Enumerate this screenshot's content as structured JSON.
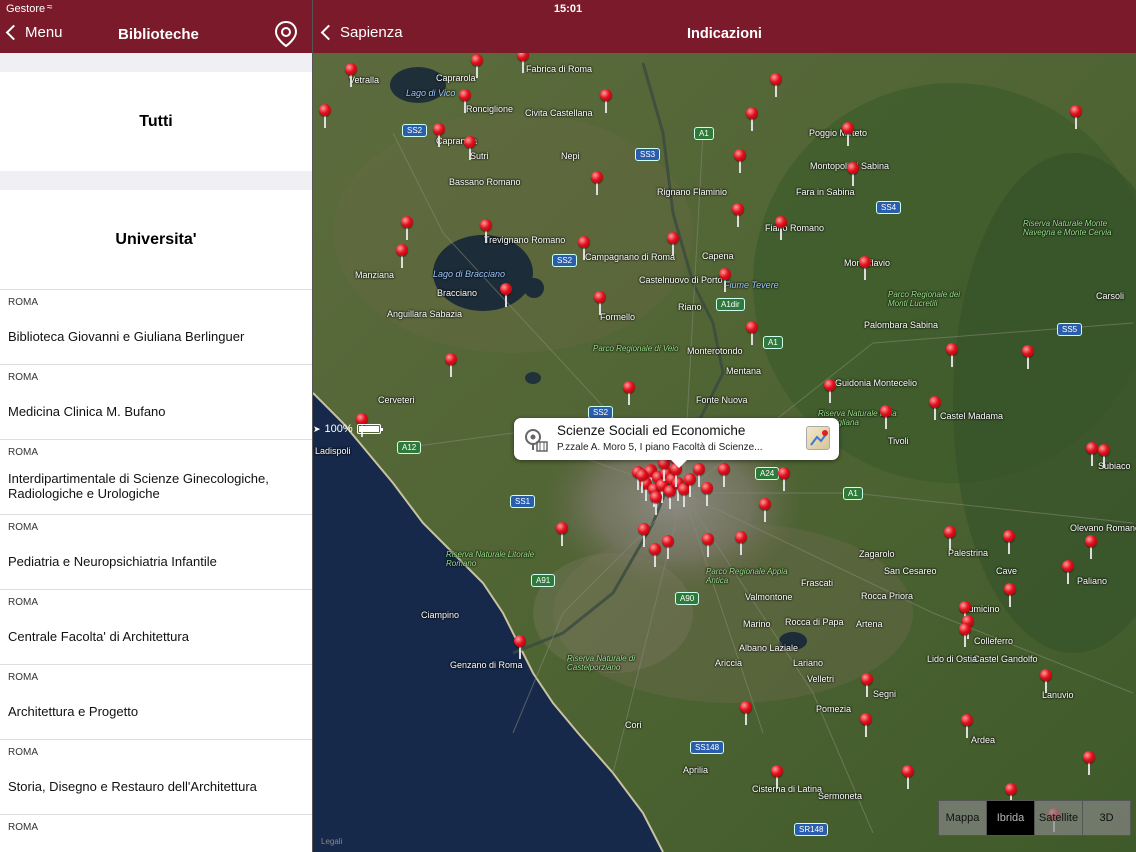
{
  "status": {
    "carrier": "Gestore",
    "time": "15:01",
    "battery": "100%"
  },
  "left_nav": {
    "back_label": "Menu",
    "title": "Biblioteche"
  },
  "right_nav": {
    "back_label": "Sapienza",
    "title": "Indicazioni"
  },
  "list": {
    "all_label": "Tutti",
    "section_label": "Universita'",
    "items": [
      {
        "city": "ROMA",
        "name": "Biblioteca Giovanni e Giuliana Berlinguer"
      },
      {
        "city": "ROMA",
        "name": "Medicina Clinica M. Bufano"
      },
      {
        "city": "ROMA",
        "name": "Interdipartimentale  di Scienze Ginecologiche, Radiologiche e Urologiche"
      },
      {
        "city": "ROMA",
        "name": "Pediatria e Neuropsichiatria Infantile"
      },
      {
        "city": "ROMA",
        "name": "Centrale Facolta' di Architettura"
      },
      {
        "city": "ROMA",
        "name": "Architettura e Progetto"
      },
      {
        "city": "ROMA",
        "name": "Storia, Disegno e Restauro dell'Architettura"
      },
      {
        "city": "ROMA",
        "name": ""
      }
    ]
  },
  "map": {
    "callout": {
      "title": "Scienze Sociali ed Economiche",
      "subtitle": "P.zzale A. Moro 5, I piano Facoltà di Scienze..."
    },
    "map_type_options": [
      "Mappa",
      "Ibrida",
      "Satellite",
      "3D"
    ],
    "selected_map_type": "Ibrida",
    "place_labels": [
      "Vetralla",
      "Caprarola",
      "Fabrica di Roma",
      "Ronciglione",
      "Civita Castellana",
      "Capranica",
      "Sutri",
      "Nepi",
      "Poggio Mirteto",
      "Montopoli di Sabina",
      "Bassano Romano",
      "Rignano Flaminio",
      "Fara in Sabina",
      "Fiano Romano",
      "Trevignano Romano",
      "Campagnano di Roma",
      "Capena",
      "Manziana",
      "Bracciano",
      "Castelnuovo di Porto",
      "Monterotondo",
      "Anguillara Sabazia",
      "Formello",
      "Riano",
      "Mentana",
      "Monteflavio",
      "Palombara Sabina",
      "Carsoli",
      "Cerveteri",
      "Fonte Nuova",
      "Guidonia Montecelio",
      "Castel Madama",
      "Tivoli",
      "Ladispoli",
      "Subiaco",
      "Olevano Romano",
      "Palestrina",
      "Zagarolo",
      "San Cesareo",
      "Cave",
      "Paliano",
      "Frascati",
      "Rocca Priora",
      "Valmontone",
      "Fiumicino",
      "Ciampino",
      "Marino",
      "Rocca di Papa",
      "Artena",
      "Colleferro",
      "Castel Gandolfo",
      "Albano Laziale",
      "Ariccia",
      "Lariano",
      "Lido di Ostia",
      "Genzano di Roma",
      "Velletri",
      "Segni",
      "Lanuvio",
      "Pomezia",
      "Cori",
      "Ardea",
      "Aprilia",
      "Cisterna di Latina",
      "Sermoneta"
    ],
    "water_labels": [
      "Lago di Vico",
      "Lago di Bracciano",
      "Fiume Tevere"
    ],
    "park_labels": [
      "Riserva Naturale Monte Navegna e Monte Cervia",
      "Parco Regionale dei Monti Lucretili",
      "Parco Regionale di Veio",
      "Riserva Naturale della Marcigliana",
      "Riserva Naturale Litorale Romano",
      "Parco Regionale Appia Antica",
      "Riserva Naturale di Castelporziano"
    ],
    "road_shields": [
      "SS2",
      "A1",
      "SS3",
      "SS4",
      "SS2",
      "A1dir",
      "A1",
      "SS5",
      "A12",
      "SS2",
      "A24",
      "SS1",
      "A1",
      "A91",
      "A90",
      "SS148",
      "SR148"
    ],
    "legal_label": "Legali"
  }
}
